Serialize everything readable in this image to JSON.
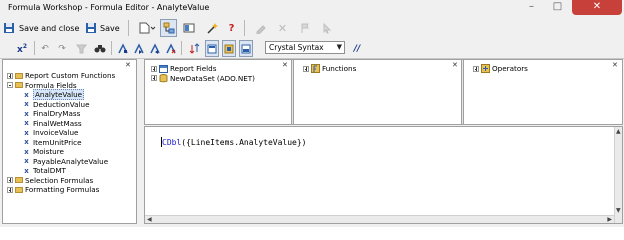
{
  "window": {
    "title": "Formula Workshop - Formula Editor - AnalyteValue"
  },
  "toolbar1": {
    "save_close_label": "Save and close",
    "save_label": "Save"
  },
  "toolbar2": {
    "syntax_selected": "Crystal Syntax"
  },
  "left_tree": {
    "items": [
      {
        "label": "Report Custom Functions"
      },
      {
        "label": "Formula Fields"
      },
      {
        "label": "AnalyteValue"
      },
      {
        "label": "DeductionValue"
      },
      {
        "label": "FinalDryMass"
      },
      {
        "label": "FinalWetMass"
      },
      {
        "label": "InvoiceValue"
      },
      {
        "label": "ItemUnitPrice"
      },
      {
        "label": "Moisture"
      },
      {
        "label": "PayableAnalyteValue"
      },
      {
        "label": "TotalDMT"
      },
      {
        "label": "Selection Formulas"
      },
      {
        "label": "Formatting Formulas"
      }
    ]
  },
  "fields_tree": {
    "report_fields": "Report Fields",
    "dataset": "NewDataSet (ADO.NET)"
  },
  "functions_tree": {
    "functions": "Functions"
  },
  "operators_tree": {
    "operators": "Operators"
  },
  "editor": {
    "keyword": "CDbl",
    "expression": "({LineItems.AnalyteValue})"
  },
  "colors": {
    "selection": "#d6e6f8",
    "keyword": "#1e1ec8",
    "close_button": "#c7403a",
    "folder": "#e8c055"
  }
}
